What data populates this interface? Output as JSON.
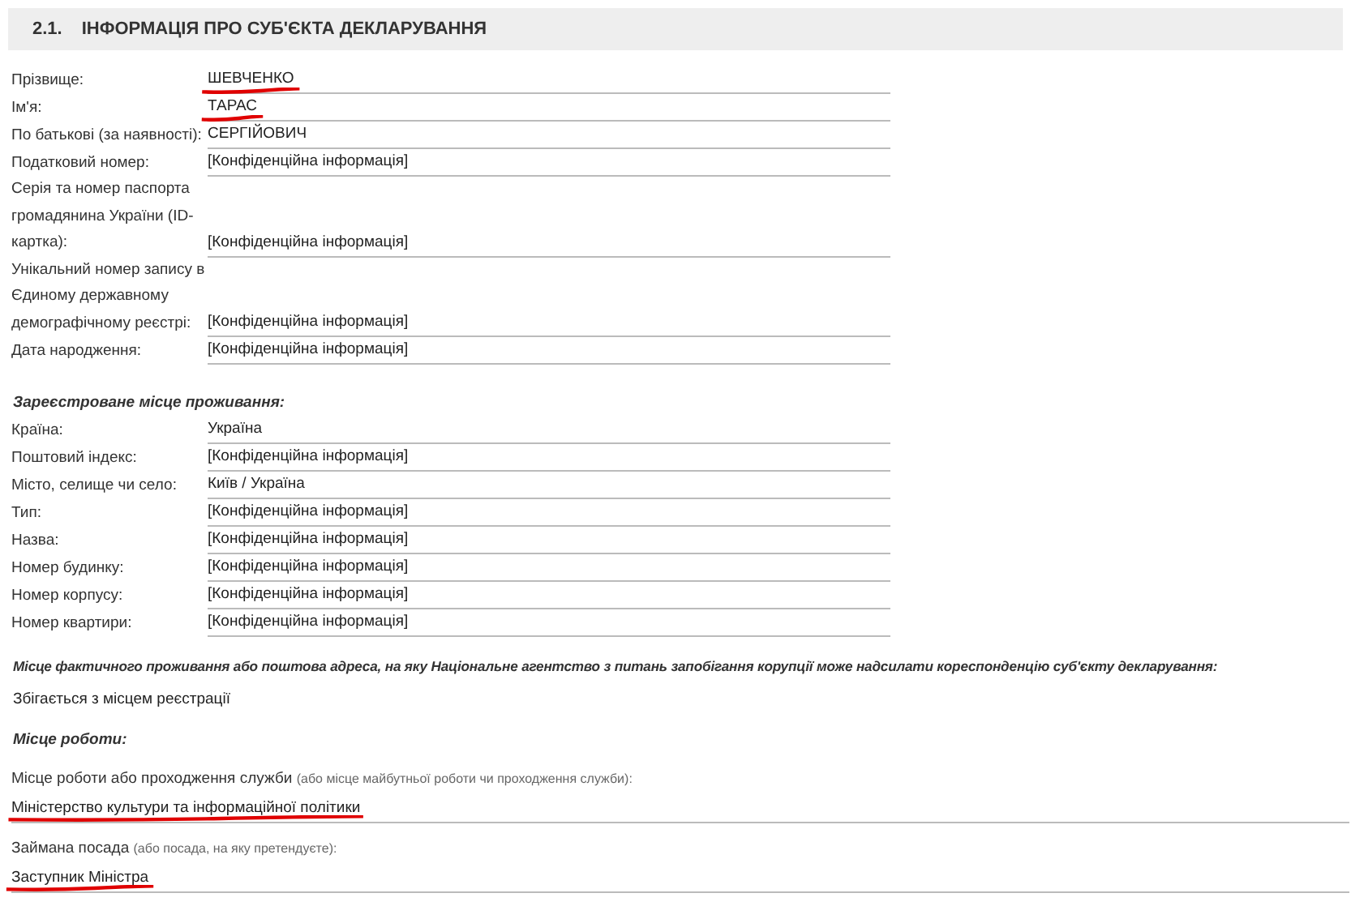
{
  "section": {
    "number": "2.1.",
    "title": "ІНФОРМАЦІЯ ПРО СУБ'ЄКТА ДЕКЛАРУВАННЯ"
  },
  "personal_fields": [
    {
      "label": "Прізвище:",
      "value": "ШЕВЧЕНКО",
      "underlined": true
    },
    {
      "label": "Ім'я:",
      "value": "ТАРАС",
      "underlined": true
    },
    {
      "label": "По батькові (за наявності):",
      "value": "СЕРГІЙОВИЧ",
      "underlined": false
    },
    {
      "label": "Податковий номер:",
      "value": "[Конфіденційна інформація]",
      "underlined": false
    },
    {
      "label": "Серія та номер паспорта громадянина України (ID-картка):",
      "value": "[Конфіденційна інформація]",
      "underlined": false
    },
    {
      "label": "Унікальний номер запису в Єдиному державному демографічному реєстрі:",
      "value": "[Конфіденційна інформація]",
      "underlined": false
    },
    {
      "label": "Дата народження:",
      "value": "[Конфіденційна інформація]",
      "underlined": false
    }
  ],
  "address": {
    "heading": "Зареєстроване місце проживання:",
    "fields": [
      {
        "label": "Країна:",
        "value": "Україна"
      },
      {
        "label": "Поштовий індекс:",
        "value": "[Конфіденційна інформація]"
      },
      {
        "label": "Місто, селище чи село:",
        "value": "Київ / Україна"
      },
      {
        "label": "Тип:",
        "value": "[Конфіденційна інформація]"
      },
      {
        "label": "Назва:",
        "value": "[Конфіденційна інформація]"
      },
      {
        "label": "Номер будинку:",
        "value": "[Конфіденційна інформація]"
      },
      {
        "label": "Номер корпусу:",
        "value": "[Конфіденційна інформація]"
      },
      {
        "label": "Номер квартири:",
        "value": "[Конфіденційна інформація]"
      }
    ]
  },
  "correspondence": {
    "heading": "Місце фактичного проживання або поштова адреса, на яку Національне агентство з питань запобігання корупції може надсилати кореспонденцію суб'єкту декларування:",
    "value": "Збігається з місцем реєстрації"
  },
  "work": {
    "heading": "Місце роботи:",
    "fields": [
      {
        "label": "Місце роботи або проходження служби",
        "note": "(або місце майбутньої роботи чи проходження служби):",
        "value": "Міністерство культури та інформаційної політики",
        "underlined": true
      },
      {
        "label": "Займана посада",
        "note": "(або посада, на яку претендуєте):",
        "value": "Заступник Міністра",
        "underlined": true
      }
    ]
  }
}
